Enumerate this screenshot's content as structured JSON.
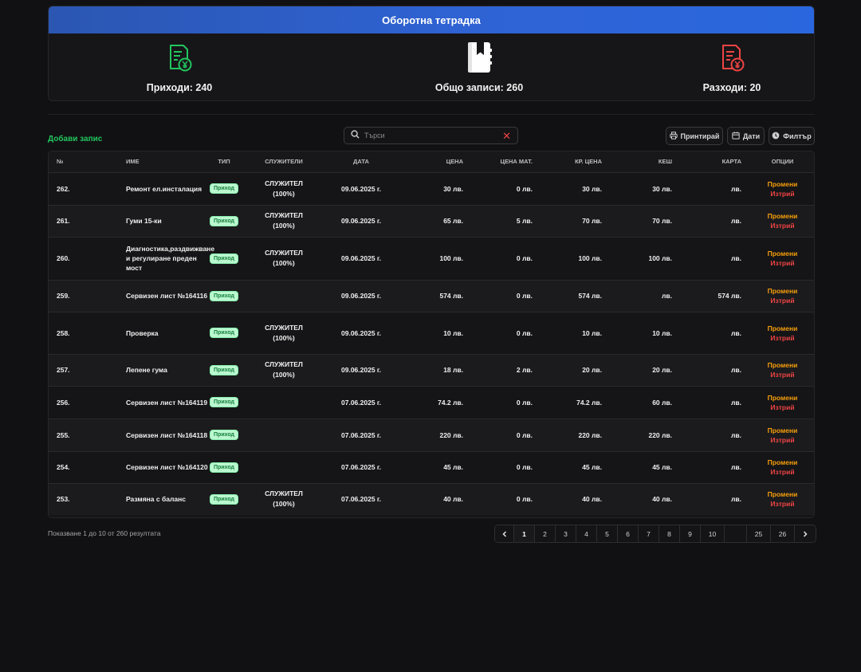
{
  "header": {
    "title": "Оборотна тетрадка"
  },
  "stats": {
    "income": "Приходи: 240",
    "total": "Общо записи: 260",
    "expense": "Разходи: 20",
    "income_color": "#22c55e",
    "expense_color": "#ef4444"
  },
  "toolbar": {
    "add_label": "Добави запис",
    "search_placeholder": "Търси",
    "print_label": "Принтирай",
    "dates_label": "Дати",
    "filter_label": "Филтър"
  },
  "table": {
    "headers": [
      "№",
      "Име",
      "Тип",
      "Служители",
      "Дата",
      "Цена",
      "Цена мат.",
      "Кр. цена",
      "Кеш",
      "Карта",
      "Опции"
    ],
    "rows": [
      {
        "no": "262.",
        "name": "Ремонт ел.инсталация",
        "type": "Приход",
        "emp": "СЛУЖИТЕЛ (100%)",
        "date": "09.06.2025 г.",
        "price": "30 лв.",
        "mat": "0 лв.",
        "final": "30 лв.",
        "cash": "30 лв.",
        "card": "лв.",
        "edit": "Промени",
        "del": "Изтрий"
      },
      {
        "no": "261.",
        "name": "Гуми 15-ки",
        "type": "Приход",
        "emp": "СЛУЖИТЕЛ (100%)",
        "date": "09.06.2025 г.",
        "price": "65 лв.",
        "mat": "5 лв.",
        "final": "70 лв.",
        "cash": "70 лв.",
        "card": "лв.",
        "edit": "Промени",
        "del": "Изтрий"
      },
      {
        "no": "260.",
        "name": "Диагностика,раздвижване и регулиране преден мост",
        "type": "Приход",
        "emp": "СЛУЖИТЕЛ (100%)",
        "date": "09.06.2025 г.",
        "price": "100 лв.",
        "mat": "0 лв.",
        "final": "100 лв.",
        "cash": "100 лв.",
        "card": "лв.",
        "edit": "Промени",
        "del": "Изтрий"
      },
      {
        "no": "259.",
        "name": "Сервизен лист №164116",
        "type": "Приход",
        "emp": "",
        "date": "09.06.2025 г.",
        "price": "574 лв.",
        "mat": "0 лв.",
        "final": "574 лв.",
        "cash": "лв.",
        "card": "574 лв.",
        "edit": "Промени",
        "del": "Изтрий"
      },
      {
        "no": "258.",
        "name": "Проверка",
        "type": "Приход",
        "emp": "СЛУЖИТЕЛ (100%)",
        "date": "09.06.2025 г.",
        "price": "10 лв.",
        "mat": "0 лв.",
        "final": "10 лв.",
        "cash": "10 лв.",
        "card": "лв.",
        "edit": "Промени",
        "del": "Изтрий"
      },
      {
        "no": "257.",
        "name": "Лепене гума",
        "type": "Приход",
        "emp": "СЛУЖИТЕЛ (100%)",
        "date": "09.06.2025 г.",
        "price": "18 лв.",
        "mat": "2 лв.",
        "final": "20 лв.",
        "cash": "20 лв.",
        "card": "лв.",
        "edit": "Промени",
        "del": "Изтрий"
      },
      {
        "no": "256.",
        "name": "Сервизен лист №164119",
        "type": "Приход",
        "emp": "",
        "date": "07.06.2025 г.",
        "price": "74.2 лв.",
        "mat": "0 лв.",
        "final": "74.2 лв.",
        "cash": "60 лв.",
        "card": "лв.",
        "edit": "Промени",
        "del": "Изтрий"
      },
      {
        "no": "255.",
        "name": "Сервизен лист №164118",
        "type": "Приход",
        "emp": "",
        "date": "07.06.2025 г.",
        "price": "220 лв.",
        "mat": "0 лв.",
        "final": "220 лв.",
        "cash": "220 лв.",
        "card": "лв.",
        "edit": "Промени",
        "del": "Изтрий"
      },
      {
        "no": "254.",
        "name": "Сервизен лист №164120",
        "type": "Приход",
        "emp": "",
        "date": "07.06.2025 г.",
        "price": "45 лв.",
        "mat": "0 лв.",
        "final": "45 лв.",
        "cash": "45 лв.",
        "card": "лв.",
        "edit": "Промени",
        "del": "Изтрий"
      },
      {
        "no": "253.",
        "name": "Размяна с баланс",
        "type": "Приход",
        "emp": "СЛУЖИТЕЛ (100%)",
        "date": "07.06.2025 г.",
        "price": "40 лв.",
        "mat": "0 лв.",
        "final": "40 лв.",
        "cash": "40 лв.",
        "card": "лв.",
        "edit": "Промени",
        "del": "Изтрий"
      }
    ]
  },
  "footer": {
    "info": "Показване 1 до 10 от 260 резултата",
    "pages": [
      "1",
      "2",
      "3",
      "4",
      "5",
      "6",
      "7",
      "8",
      "9",
      "10",
      "",
      "25",
      "26"
    ],
    "active_page": "1"
  }
}
